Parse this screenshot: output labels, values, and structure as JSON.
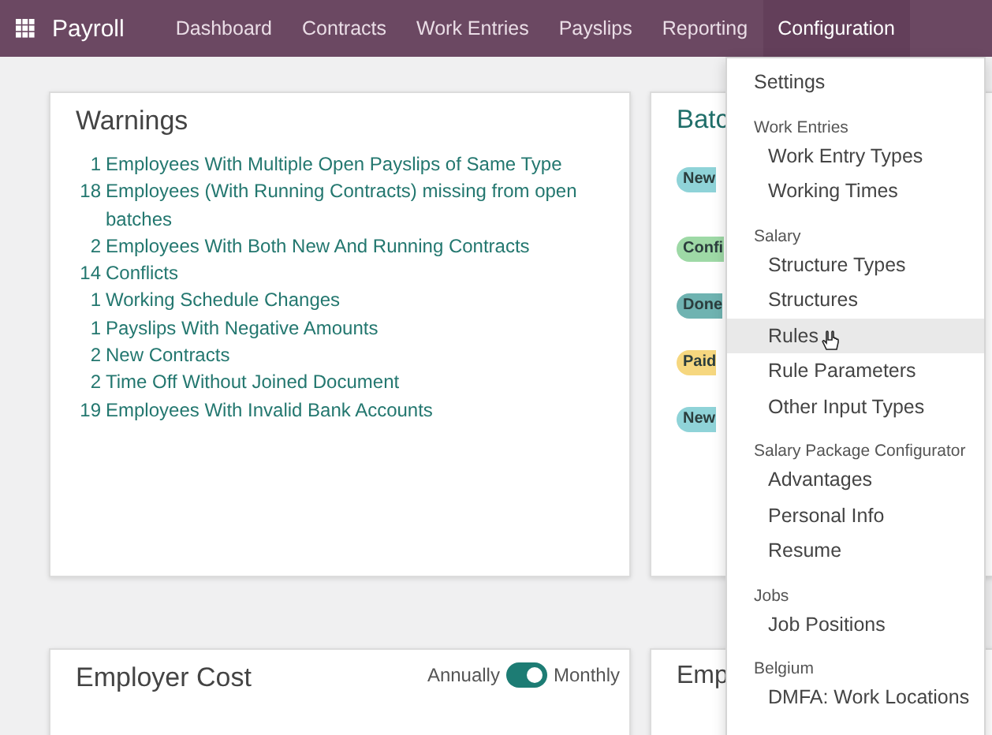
{
  "navbar": {
    "app_name": "Payroll",
    "menu": [
      {
        "label": "Dashboard",
        "selected": false
      },
      {
        "label": "Contracts",
        "selected": false
      },
      {
        "label": "Work Entries",
        "selected": false
      },
      {
        "label": "Payslips",
        "selected": false
      },
      {
        "label": "Reporting",
        "selected": false
      },
      {
        "label": "Configuration",
        "selected": true
      }
    ]
  },
  "warnings": {
    "title": "Warnings",
    "items": [
      {
        "count": "1",
        "label": "Employees With Multiple Open Payslips of Same Type"
      },
      {
        "count": "18",
        "label": "Employees (With Running Contracts) missing from open batches"
      },
      {
        "count": "2",
        "label": "Employees With Both New And Running Contracts"
      },
      {
        "count": "14",
        "label": "Conflicts"
      },
      {
        "count": "1",
        "label": "Working Schedule Changes"
      },
      {
        "count": "1",
        "label": "Payslips With Negative Amounts"
      },
      {
        "count": "2",
        "label": "New Contracts"
      },
      {
        "count": "2",
        "label": "Time Off Without Joined Document"
      },
      {
        "count": "19",
        "label": "Employees With Invalid Bank Accounts"
      }
    ]
  },
  "batches": {
    "title": "Batc",
    "badges": [
      {
        "label": "New",
        "color": "#8fd3d8"
      },
      {
        "label": "Confi",
        "color": "#9ed9a6"
      },
      {
        "label": "Done",
        "color": "#6fb3b1"
      },
      {
        "label": "Paid",
        "color": "#f6d77f"
      },
      {
        "label": "New",
        "color": "#8fd3d8"
      }
    ]
  },
  "employer_cost": {
    "title": "Employer Cost",
    "toggle": {
      "left_label": "Annually",
      "right_label": "Monthly",
      "on": true
    }
  },
  "bottom_card": {
    "title": "Emp"
  },
  "configuration_menu": {
    "sections": [
      {
        "items": [
          {
            "label": "Settings",
            "selected": false
          }
        ]
      },
      {
        "header": "Work Entries",
        "items": [
          {
            "label": "Work Entry Types",
            "selected": false
          },
          {
            "label": "Working Times",
            "selected": false
          }
        ]
      },
      {
        "header": "Salary",
        "items": [
          {
            "label": "Structure Types",
            "selected": false
          },
          {
            "label": "Structures",
            "selected": false
          },
          {
            "label": "Rules",
            "selected": true
          },
          {
            "label": "Rule Parameters",
            "selected": false
          },
          {
            "label": "Other Input Types",
            "selected": false
          }
        ]
      },
      {
        "header": "Salary Package Configurator",
        "items": [
          {
            "label": "Advantages",
            "selected": false
          },
          {
            "label": "Personal Info",
            "selected": false
          },
          {
            "label": "Resume",
            "selected": false
          }
        ]
      },
      {
        "header": "Jobs",
        "items": [
          {
            "label": "Job Positions",
            "selected": false
          }
        ]
      },
      {
        "header": "Belgium",
        "items": [
          {
            "label": "DMFA: Work Locations",
            "selected": false
          }
        ]
      }
    ]
  }
}
